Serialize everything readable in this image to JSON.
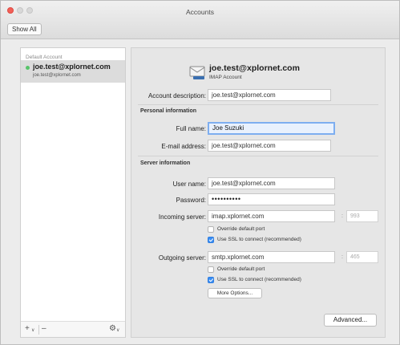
{
  "window": {
    "title": "Accounts",
    "show_all_label": "Show All"
  },
  "sidebar": {
    "section_label": "Default Account",
    "account": {
      "name": "joe.test@xplornet.com",
      "subtitle": "joe.test@xplornet.com"
    },
    "footer": {
      "add": "+",
      "add_menu": "∨",
      "remove": "–",
      "gear": "⚙",
      "gear_menu": "∨"
    }
  },
  "header": {
    "email": "joe.test@xplornet.com",
    "account_type": "IMAP Account"
  },
  "form": {
    "account_description": {
      "label": "Account description:",
      "value": "joe.test@xplornet.com"
    },
    "personal_section": "Personal information",
    "full_name": {
      "label": "Full name:",
      "value": "Joe Suzuki"
    },
    "email_address": {
      "label": "E-mail address:",
      "value": "joe.test@xplornet.com"
    },
    "server_section": "Server information",
    "user_name": {
      "label": "User name:",
      "value": "joe.test@xplornet.com"
    },
    "password": {
      "label": "Password:",
      "value": "••••••••••"
    },
    "incoming": {
      "label": "Incoming server:",
      "value": "imap.xplornet.com",
      "port": "993",
      "override_label": "Override default port",
      "override_checked": false,
      "ssl_label": "Use SSL to connect (recommended)",
      "ssl_checked": true
    },
    "outgoing": {
      "label": "Outgoing server:",
      "value": "smtp.xplornet.com",
      "port": "465",
      "override_label": "Override default port",
      "override_checked": false,
      "ssl_label": "Use SSL to connect (recommended)",
      "ssl_checked": true,
      "more_options_label": "More Options..."
    },
    "advanced_label": "Advanced...",
    "port_colon": ":"
  },
  "colors": {
    "accent": "#3b8ef2",
    "focus_ring": "#7eaef0",
    "status_green": "#57c46a",
    "close_red": "#f25f57"
  },
  "icons": {
    "header": "envelope-icon",
    "gear": "gear-icon"
  }
}
